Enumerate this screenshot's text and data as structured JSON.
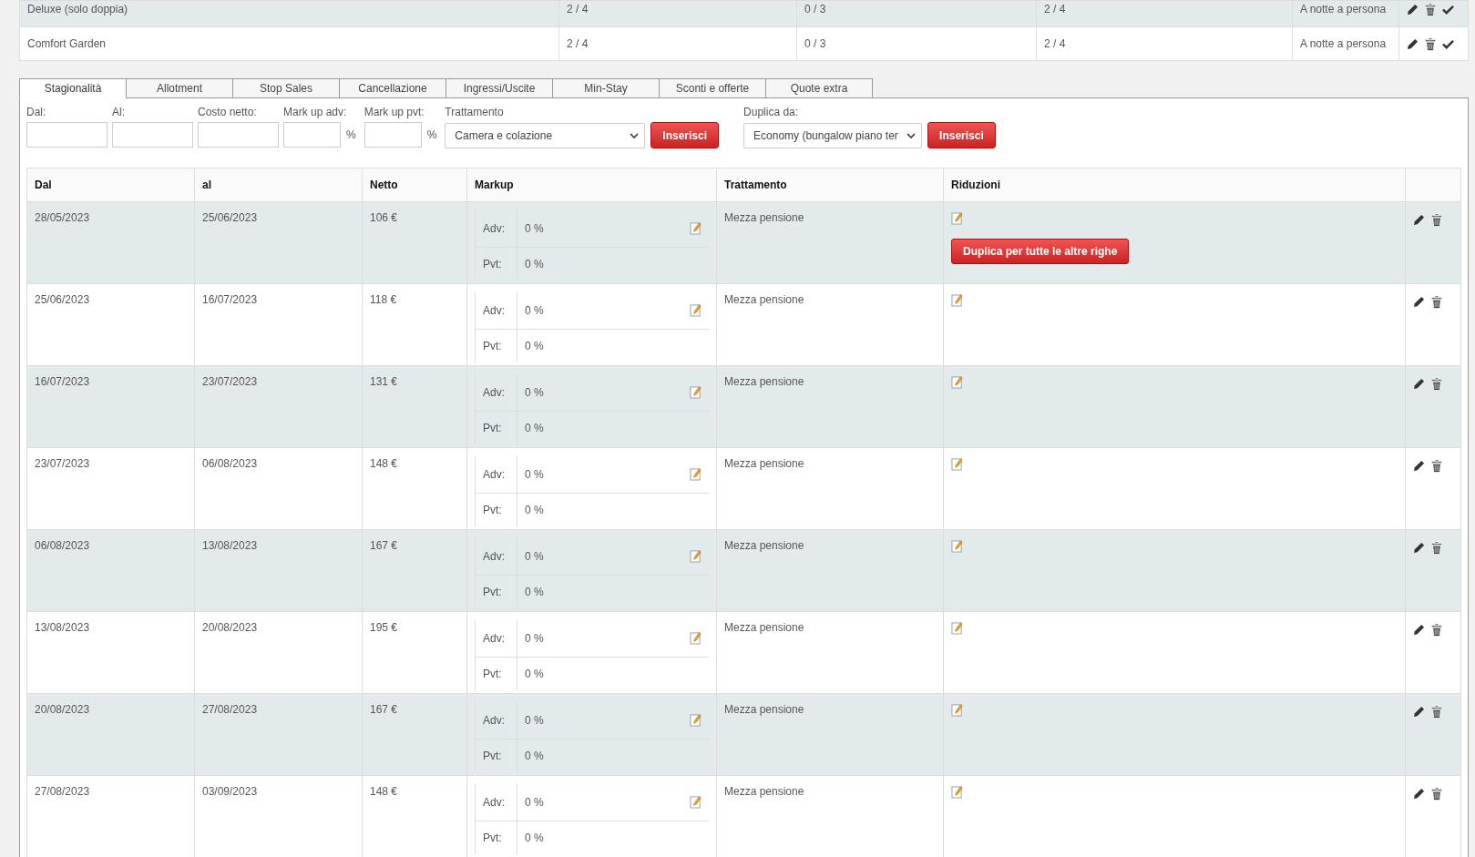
{
  "rooms": [
    {
      "name": "Deluxe (solo doppia)",
      "column_2": "2  / 4",
      "column_3": "0  / 3",
      "column_4": "2  / 4",
      "pricing": "A notte a persona"
    },
    {
      "name": "Comfort Garden",
      "column_2": "2  / 4",
      "column_3": "0  / 3",
      "column_4": "2  / 4",
      "pricing": "A notte a persona"
    }
  ],
  "tabs": [
    {
      "label": "Stagionalità",
      "selected": true
    },
    {
      "label": "Allotment",
      "selected": false
    },
    {
      "label": "Stop Sales",
      "selected": false
    },
    {
      "label": "Cancellazione",
      "selected": false
    },
    {
      "label": "Ingressi/Uscite",
      "selected": false
    },
    {
      "label": "Min-Stay",
      "selected": false
    },
    {
      "label": "Sconti e offerte",
      "selected": false
    },
    {
      "label": "Quote extra",
      "selected": false
    }
  ],
  "form": {
    "dal_label": "Dal:",
    "al_label": "Al:",
    "cost_label": "Costo netto:",
    "adv_label": "Mark up adv:",
    "adv_unit": "%",
    "pvt_label": "Mark up pvt:",
    "pvt_unit": "%",
    "treatment_label": "Trattamento",
    "treatment_value": "Camera e colazione",
    "insert_button": "Inserisci",
    "duplicate_label": "Duplica da:",
    "duplicate_value": "Economy (bungalow piano ter",
    "duplicate_button": "Inserisci"
  },
  "table": {
    "columns": [
      "Dal",
      "al",
      "Netto",
      "Markup",
      "Trattamento",
      "Riduzioni"
    ],
    "rows": [
      {
        "dal": "28/05/2023",
        "al": "25/06/2023",
        "netto": "106 €",
        "adv_label": "Adv:",
        "adv": "0 %",
        "pvt_label": "Pvt:",
        "pvt": "0 %",
        "treatment": "Mezza pensione",
        "duplicate_button": "Duplica per tutte le altre righe"
      },
      {
        "dal": "25/06/2023",
        "al": "16/07/2023",
        "netto": "118 €",
        "adv_label": "Adv:",
        "adv": "0 %",
        "pvt_label": "Pvt:",
        "pvt": "0 %",
        "treatment": "Mezza pensione"
      },
      {
        "dal": "16/07/2023",
        "al": "23/07/2023",
        "netto": "131 €",
        "adv_label": "Adv:",
        "adv": "0 %",
        "pvt_label": "Pvt:",
        "pvt": "0 %",
        "treatment": "Mezza pensione"
      },
      {
        "dal": "23/07/2023",
        "al": "06/08/2023",
        "netto": "148 €",
        "adv_label": "Adv:",
        "adv": "0 %",
        "pvt_label": "Pvt:",
        "pvt": "0 %",
        "treatment": "Mezza pensione"
      },
      {
        "dal": "06/08/2023",
        "al": "13/08/2023",
        "netto": "167 €",
        "adv_label": "Adv:",
        "adv": "0 %",
        "pvt_label": "Pvt:",
        "pvt": "0 %",
        "treatment": "Mezza pensione"
      },
      {
        "dal": "13/08/2023",
        "al": "20/08/2023",
        "netto": "195 €",
        "adv_label": "Adv:",
        "adv": "0 %",
        "pvt_label": "Pvt:",
        "pvt": "0 %",
        "treatment": "Mezza pensione"
      },
      {
        "dal": "20/08/2023",
        "al": "27/08/2023",
        "netto": "167 €",
        "adv_label": "Adv:",
        "adv": "0 %",
        "pvt_label": "Pvt:",
        "pvt": "0 %",
        "treatment": "Mezza pensione"
      },
      {
        "dal": "27/08/2023",
        "al": "03/09/2023",
        "netto": "148 €",
        "adv_label": "Adv:",
        "adv": "0 %",
        "pvt_label": "Pvt:",
        "pvt": "0 %",
        "treatment": "Mezza pensione"
      }
    ]
  }
}
